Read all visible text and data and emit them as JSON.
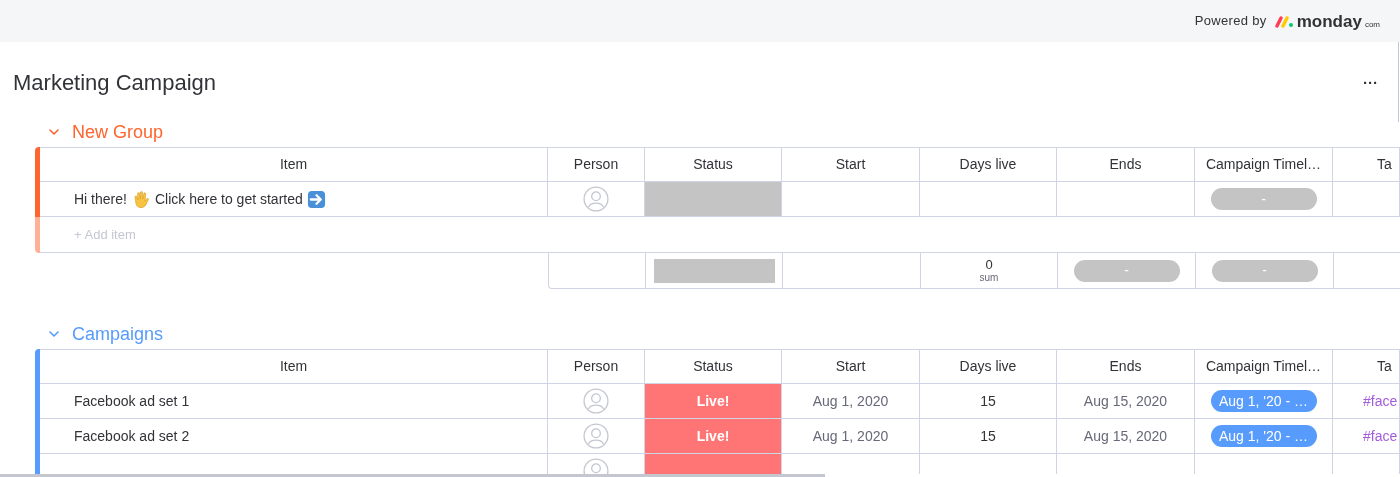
{
  "top_bar": {
    "powered_by": "Powered by",
    "brand": "monday",
    "brand_suffix": "com"
  },
  "board": {
    "title": "Marketing Campaign",
    "menu": "···"
  },
  "groups": [
    {
      "title": "New Group",
      "color": "#ff642e",
      "columns": [
        {
          "label": "Item",
          "kind": "item"
        },
        {
          "label": "Person",
          "kind": "person"
        },
        {
          "label": "Status",
          "kind": "status"
        },
        {
          "label": "Start",
          "kind": "start"
        },
        {
          "label": "Days live",
          "kind": "days_live"
        },
        {
          "label": "Ends",
          "kind": "ends"
        },
        {
          "label": "Campaign Timel…",
          "kind": "timeline"
        },
        {
          "label": "Ta",
          "kind": "column_8"
        }
      ],
      "rows": [
        {
          "kind": "intro",
          "item": [
            "Hi there!",
            "Click here to get started"
          ],
          "status": {
            "color": "#c4c4c4"
          },
          "timeline": {
            "label": "-",
            "color": "#c4c4c4"
          }
        }
      ],
      "add_item": "+ Add item",
      "summary": {
        "status": {
          "color": "#c4c4c4"
        },
        "days_live": {
          "value": "0",
          "label": "sum"
        },
        "ends": {
          "label": "-",
          "color": "#c4c4c4"
        },
        "timeline": {
          "label": "-",
          "color": "#c4c4c4"
        }
      }
    },
    {
      "title": "Campaigns",
      "color": "#579bfc",
      "columns": [
        {
          "label": "Item",
          "kind": "item"
        },
        {
          "label": "Person",
          "kind": "person"
        },
        {
          "label": "Status",
          "kind": "status"
        },
        {
          "label": "Start",
          "kind": "start"
        },
        {
          "label": "Days live",
          "kind": "days_live"
        },
        {
          "label": "Ends",
          "kind": "ends"
        },
        {
          "label": "Campaign Timel…",
          "kind": "timeline"
        },
        {
          "label": "Ta",
          "kind": "column_8"
        }
      ],
      "rows": [
        {
          "kind": "plain",
          "item": [
            "Facebook ad set 1"
          ],
          "status": {
            "label": "Live!",
            "color": "#ff7575"
          },
          "start": "Aug 1, 2020",
          "days_live": "15",
          "ends": "Aug 15, 2020",
          "timeline": {
            "label": "Aug 1, '20 - …",
            "color": "#579bfc"
          },
          "column_8": "#face"
        },
        {
          "kind": "plain",
          "item": [
            "Facebook ad set 2"
          ],
          "status": {
            "label": "Live!",
            "color": "#ff7575"
          },
          "start": "Aug 1, 2020",
          "days_live": "15",
          "ends": "Aug 15, 2020",
          "timeline": {
            "label": "Aug 1, '20 - …",
            "color": "#579bfc"
          },
          "column_8": "#face"
        },
        {
          "kind": "plain",
          "status": {
            "color": "#ff7575"
          }
        }
      ]
    }
  ]
}
